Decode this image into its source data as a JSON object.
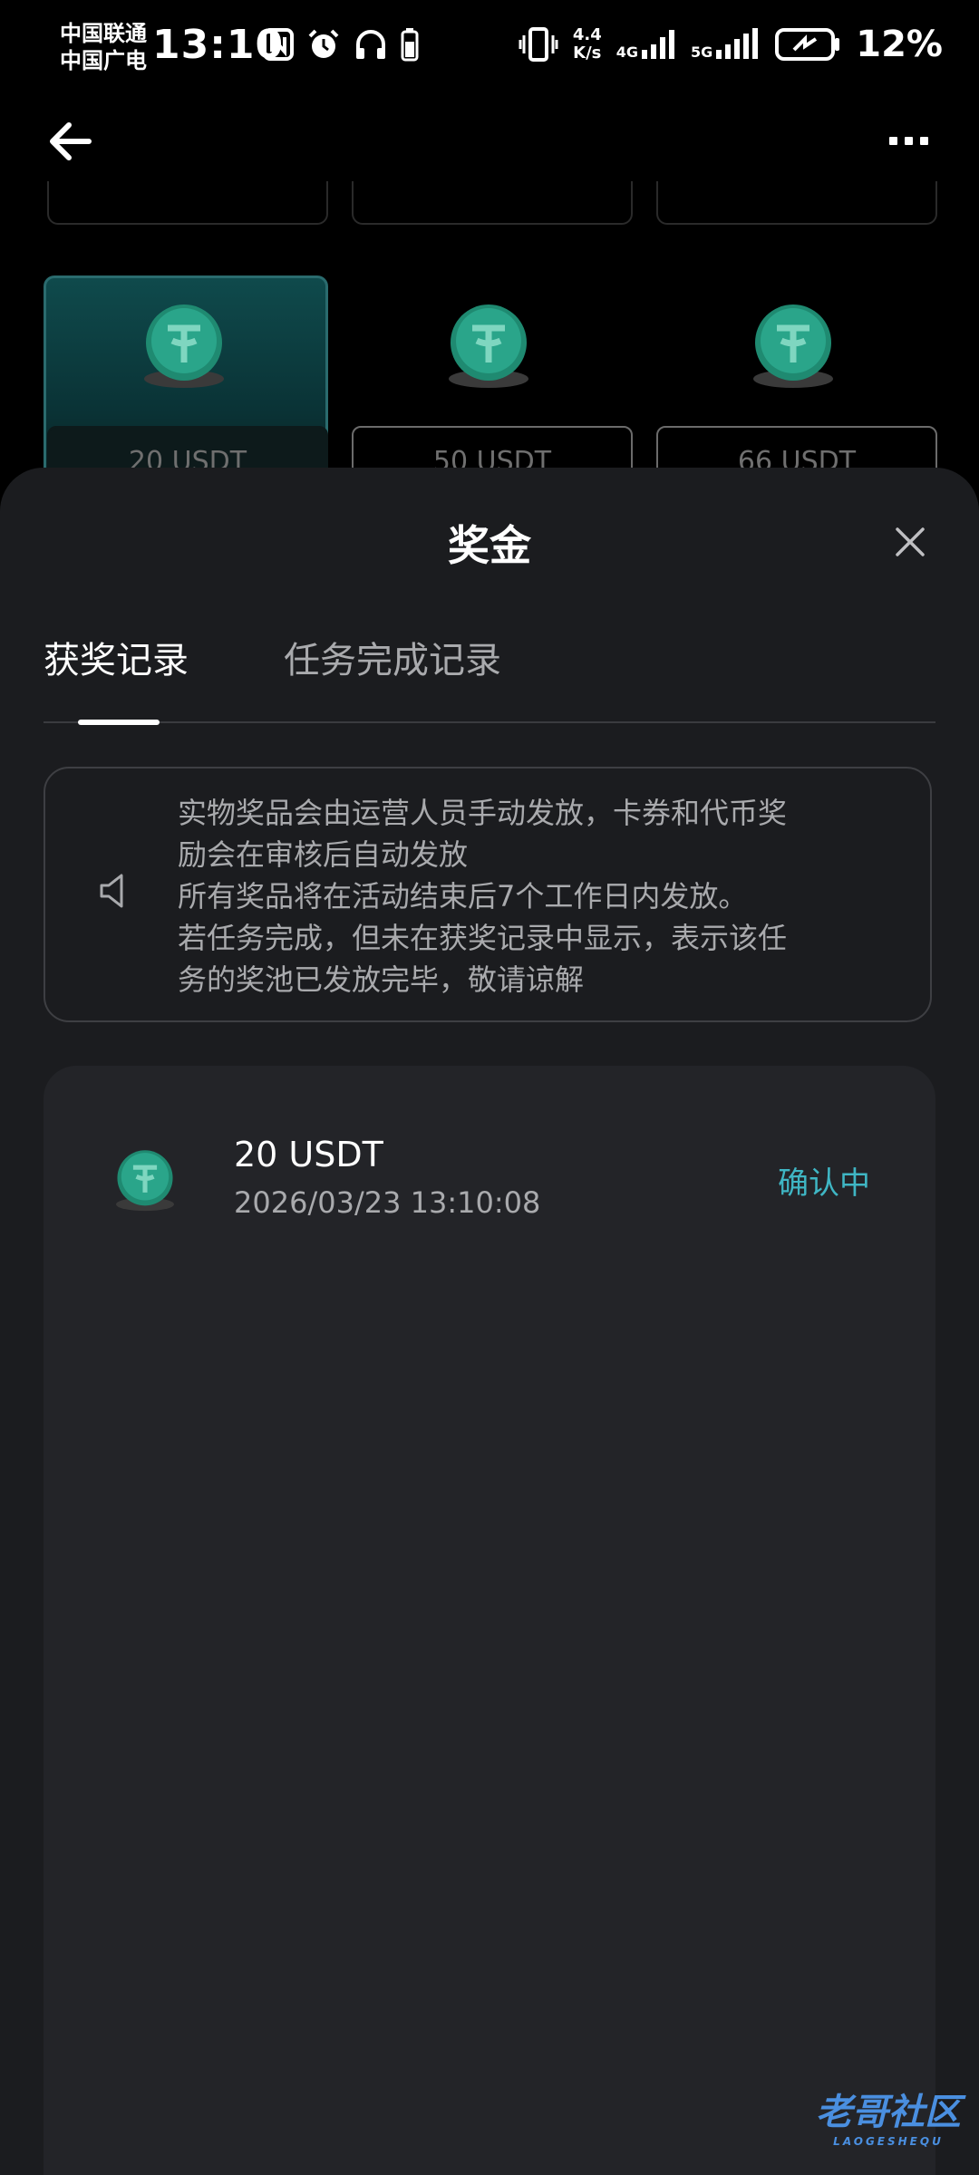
{
  "status_bar": {
    "carrier_1": "中国联通",
    "carrier_2": "中国广电",
    "time": "13:10",
    "net_speed": "4.4",
    "net_speed_unit": "K/s",
    "net_1": "4G",
    "net_2": "5G",
    "battery": "12%"
  },
  "prizes": [
    {
      "label": "20 USDT",
      "selected": true
    },
    {
      "label": "50 USDT",
      "selected": false
    },
    {
      "label": "66 USDT",
      "selected": false
    }
  ],
  "sheet": {
    "title": "奖金",
    "tabs": [
      {
        "label": "获奖记录",
        "active": true
      },
      {
        "label": "任务完成记录",
        "active": false
      }
    ],
    "notice_lines": [
      "实物奖品会由运营人员手动发放，卡券和代币奖",
      "励会在审核后自动发放",
      "所有奖品将在活动结束后7个工作日内发放。",
      "若任务完成，但未在获奖记录中显示，表示该任",
      "务的奖池已发放完毕，敬请谅解"
    ],
    "records": [
      {
        "title": "20 USDT",
        "time": "2026/03/23 13:10:08",
        "status": "确认中"
      }
    ]
  },
  "watermark": {
    "text": "老哥社区",
    "sub": "LAOGESHEQU"
  },
  "colors": {
    "accent": "#3fb6c4",
    "sheet_bg": "#1b1c1f",
    "panel_bg": "#232428",
    "coin": "#2aa58a"
  },
  "icons": [
    "back-arrow-icon",
    "more-icon",
    "close-icon",
    "speaker-icon",
    "usdt-coin-icon"
  ]
}
